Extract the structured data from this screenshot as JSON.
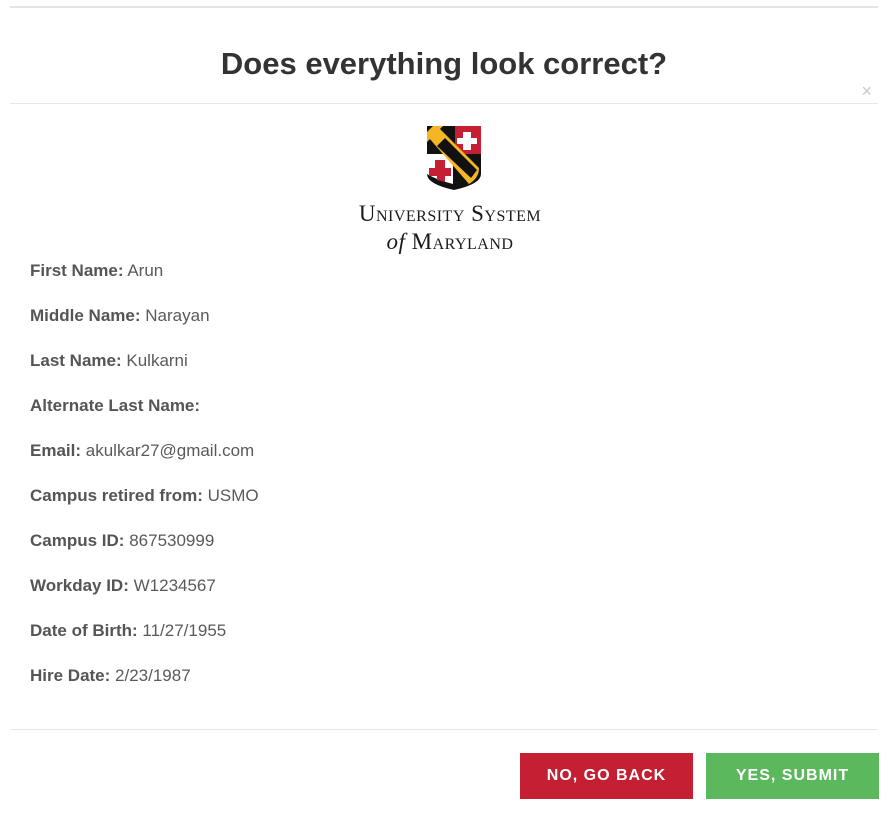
{
  "dialog": {
    "title": "Does everything look correct?",
    "close_glyph": "×"
  },
  "logo": {
    "line1": "University System",
    "line2_of": "of",
    "line2_rest": "Maryland",
    "colors": {
      "red": "#c41f32",
      "gold": "#f5b625",
      "black": "#111111",
      "white": "#ffffff"
    }
  },
  "fields": [
    {
      "label": "First Name:",
      "value": "Arun"
    },
    {
      "label": "Middle Name:",
      "value": "Narayan"
    },
    {
      "label": "Last Name:",
      "value": "Kulkarni"
    },
    {
      "label": "Alternate Last Name:",
      "value": ""
    },
    {
      "label": "Email:",
      "value": "akulkar27@gmail.com"
    },
    {
      "label": "Campus retired from:",
      "value": "USMO"
    },
    {
      "label": "Campus ID:",
      "value": "867530999"
    },
    {
      "label": "Workday ID:",
      "value": "W1234567"
    },
    {
      "label": "Date of Birth:",
      "value": "11/27/1955"
    },
    {
      "label": "Hire Date:",
      "value": "2/23/1987"
    }
  ],
  "buttons": {
    "back_label": "NO, GO BACK",
    "submit_label": "YES, SUBMIT",
    "back_color": "#c41f32",
    "submit_color": "#5cb85c"
  }
}
